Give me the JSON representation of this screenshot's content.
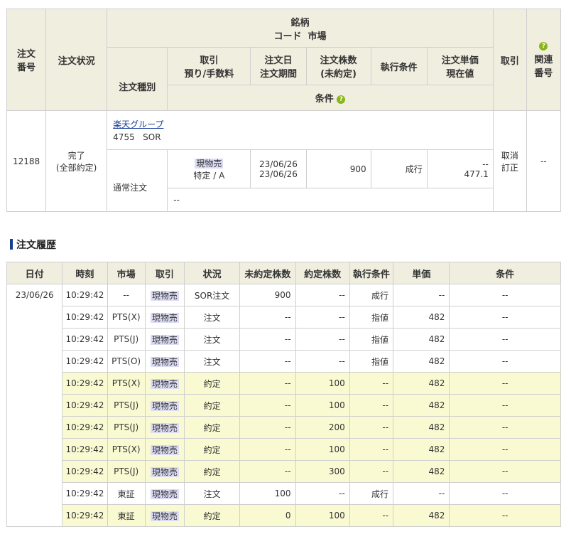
{
  "order": {
    "headers": {
      "order_no": "注文\n番号",
      "status": "注文状況",
      "meigara": "銘柄",
      "code_market": "コード  市場",
      "order_type": "注文種別",
      "trade": "取引\n預り/手数料",
      "order_date": "注文日\n注文期間",
      "qty": "注文株数\n(未約定)",
      "exec": "執行条件",
      "price": "注文単価\n現在値",
      "action": "取引",
      "related": "関連\n番号",
      "condition": "条件"
    },
    "row": {
      "order_no": "12188",
      "status": "完了\n(全部約定)",
      "stock_name": "楽天グループ",
      "code_market": "4755   SOR",
      "order_type": "通常注文",
      "trade_type": "現物売",
      "account_fee": "特定 / A",
      "order_date": "23/06/26",
      "order_period": "23/06/26",
      "qty": "900",
      "exec": "成行",
      "order_price": "--",
      "current_price": "477.1",
      "cancel": "取消",
      "modify": "訂正",
      "related": "--",
      "condition": "--"
    }
  },
  "history": {
    "title": "注文履歴",
    "columns": [
      "日付",
      "時刻",
      "市場",
      "取引",
      "状況",
      "未約定株数",
      "約定株数",
      "執行条件",
      "単価",
      "条件"
    ],
    "date": "23/06/26",
    "rows": [
      {
        "time": "10:29:42",
        "market": "--",
        "trade": "現物売",
        "status": "SOR注文",
        "unfilled": "900",
        "filled": "--",
        "exec": "成行",
        "price": "--",
        "cond": "--",
        "y": false
      },
      {
        "time": "10:29:42",
        "market": "PTS(X)",
        "trade": "現物売",
        "status": "注文",
        "unfilled": "--",
        "filled": "--",
        "exec": "指値",
        "price": "482",
        "cond": "--",
        "y": false
      },
      {
        "time": "10:29:42",
        "market": "PTS(J)",
        "trade": "現物売",
        "status": "注文",
        "unfilled": "--",
        "filled": "--",
        "exec": "指値",
        "price": "482",
        "cond": "--",
        "y": false
      },
      {
        "time": "10:29:42",
        "market": "PTS(O)",
        "trade": "現物売",
        "status": "注文",
        "unfilled": "--",
        "filled": "--",
        "exec": "指値",
        "price": "482",
        "cond": "--",
        "y": false
      },
      {
        "time": "10:29:42",
        "market": "PTS(X)",
        "trade": "現物売",
        "status": "約定",
        "unfilled": "--",
        "filled": "100",
        "exec": "--",
        "price": "482",
        "cond": "--",
        "y": true
      },
      {
        "time": "10:29:42",
        "market": "PTS(J)",
        "trade": "現物売",
        "status": "約定",
        "unfilled": "--",
        "filled": "100",
        "exec": "--",
        "price": "482",
        "cond": "--",
        "y": true
      },
      {
        "time": "10:29:42",
        "market": "PTS(J)",
        "trade": "現物売",
        "status": "約定",
        "unfilled": "--",
        "filled": "200",
        "exec": "--",
        "price": "482",
        "cond": "--",
        "y": true
      },
      {
        "time": "10:29:42",
        "market": "PTS(X)",
        "trade": "現物売",
        "status": "約定",
        "unfilled": "--",
        "filled": "100",
        "exec": "--",
        "price": "482",
        "cond": "--",
        "y": true
      },
      {
        "time": "10:29:42",
        "market": "PTS(J)",
        "trade": "現物売",
        "status": "約定",
        "unfilled": "--",
        "filled": "300",
        "exec": "--",
        "price": "482",
        "cond": "--",
        "y": true
      },
      {
        "time": "10:29:42",
        "market": "東証",
        "trade": "現物売",
        "status": "注文",
        "unfilled": "100",
        "filled": "--",
        "exec": "成行",
        "price": "--",
        "cond": "--",
        "y": false
      },
      {
        "time": "10:29:42",
        "market": "東証",
        "trade": "現物売",
        "status": "約定",
        "unfilled": "0",
        "filled": "100",
        "exec": "--",
        "price": "482",
        "cond": "--",
        "y": true
      }
    ]
  }
}
